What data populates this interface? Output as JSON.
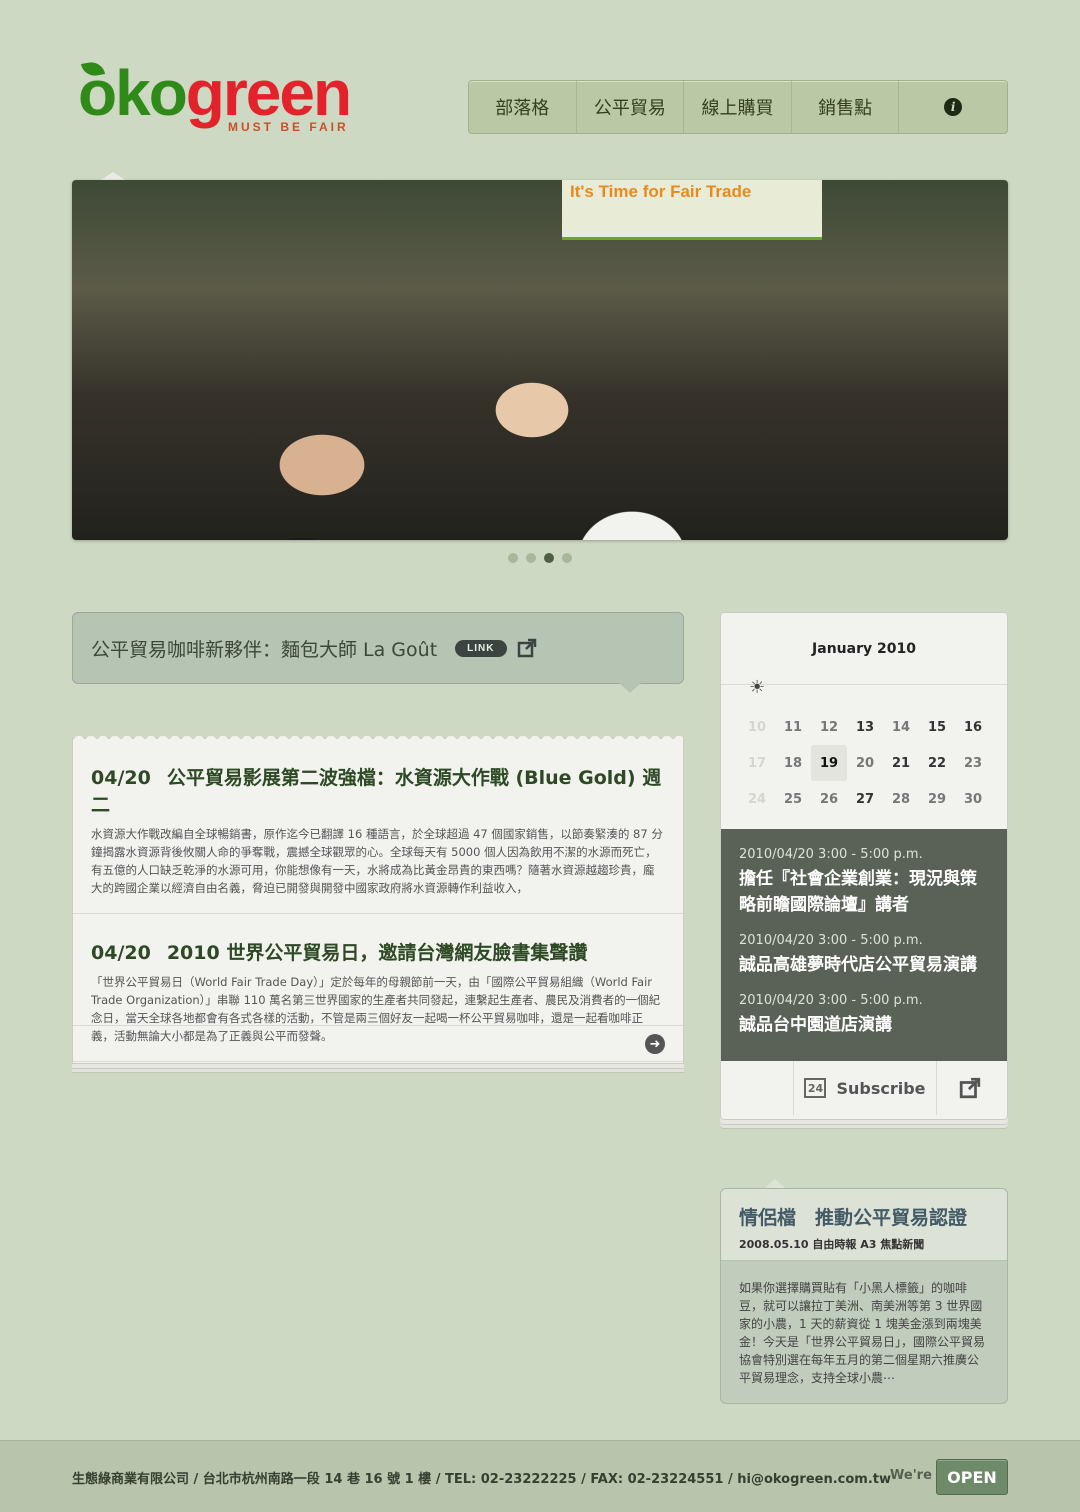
{
  "brand": {
    "logo_oko": "oko",
    "logo_green": "green",
    "tagline": "MUST BE FAIR"
  },
  "nav": {
    "items": [
      "部落格",
      "公平貿易",
      "線上購買",
      "銷售點"
    ],
    "info_icon": "info-icon"
  },
  "hero": {
    "sign_text": "It's Time for Fair Trade",
    "slides": 4,
    "active_slide": 3
  },
  "feature": {
    "title": "公平貿易咖啡新夥伴：麵包大師 La Goût",
    "badge": "LINK"
  },
  "news": [
    {
      "date": "04/20",
      "title": "公平貿易影展第二波強檔：水資源大作戰 (Blue Gold) 週二",
      "body": "水資源大作戰改編自全球暢銷書，原作迄今已翻譯 16 種語言，於全球超過 47 個國家銷售，以節奏緊湊的 87 分鐘揭露水資源背後攸關人命的爭奪戰，震撼全球觀眾的心。全球每天有 5000 個人因為飲用不潔的水源而死亡，有五億的人口缺乏乾淨的水源可用，你能想像有一天，水將成為比黃金昂貴的東西嗎？隨著水資源越趨珍貴，龐大的跨國企業以經濟自由名義，脅迫已開發與開發中國家政府將水資源轉作利益收入，"
    },
    {
      "date": "04/20",
      "title": "2010 世界公平貿易日，邀請台灣網友臉書集聲讚",
      "body": "「世界公平貿易日（World Fair Trade Day）」定於每年的母親節前一天，由「國際公平貿易組織（World Fair Trade Organization）」串聯 110 萬名第三世界國家的生產者共同發起，連繫起生產者、農民及消費者的一個紀念日，當天全球各地都會有各式各樣的活動，不管是兩三個好友一起喝一杯公平貿易咖啡，還是一起看咖啡正義，活動無論大小都是為了正義與公平而發聲。"
    }
  ],
  "calendar": {
    "month": "January 2010",
    "days": [
      {
        "d": "10",
        "s": "faded"
      },
      {
        "d": "11",
        "s": ""
      },
      {
        "d": "12",
        "s": ""
      },
      {
        "d": "13",
        "s": "dark"
      },
      {
        "d": "14",
        "s": ""
      },
      {
        "d": "15",
        "s": "dark"
      },
      {
        "d": "16",
        "s": "dark"
      },
      {
        "d": "17",
        "s": "faded"
      },
      {
        "d": "18",
        "s": ""
      },
      {
        "d": "19",
        "s": "today"
      },
      {
        "d": "20",
        "s": ""
      },
      {
        "d": "21",
        "s": "dark"
      },
      {
        "d": "22",
        "s": "dark"
      },
      {
        "d": "23",
        "s": ""
      },
      {
        "d": "24",
        "s": "faded"
      },
      {
        "d": "25",
        "s": ""
      },
      {
        "d": "26",
        "s": ""
      },
      {
        "d": "27",
        "s": "dark"
      },
      {
        "d": "28",
        "s": ""
      },
      {
        "d": "29",
        "s": ""
      },
      {
        "d": "30",
        "s": ""
      }
    ],
    "events": [
      {
        "time": "2010/04/20  3:00 - 5:00 p.m.",
        "title": "擔任『社會企業創業：現況與策略前瞻國際論壇』講者"
      },
      {
        "time": "2010/04/20  3:00 - 5:00 p.m.",
        "title": "誠品高雄夢時代店公平貿易演講"
      },
      {
        "time": "2010/04/20  3:00 - 5:00 p.m.",
        "title": "誠品台中園道店演講"
      }
    ],
    "subscribe_label": "Subscribe",
    "cal_icon_text": "24"
  },
  "press": {
    "title": "情侶檔　推動公平貿易認證",
    "source": "2008.05.10 自由時報 A3 焦點新聞",
    "body": "如果你選擇購買貼有「小黑人標籤」的咖啡豆，就可以讓拉丁美洲、南美洲等第 3 世界國家的小農，1 天的薪資從 1 塊美金漲到兩塊美金！今天是「世界公平貿易日」，國際公平貿易協會特別選在每年五月的第二個星期六推廣公平貿易理念，支持全球小農⋯"
  },
  "footer": {
    "text": "生態綠商業有限公司 / 台北市杭州南路一段 14 巷 16 號 1 樓 / TEL: 02-23222225 / FAX: 02-23224551 / hi@okogreen.com.tw",
    "were": "We're",
    "open": "OPEN"
  },
  "colors": {
    "background": "#cdd9c2",
    "logo_green": "#2f8a1a",
    "logo_red": "#e3232b",
    "event_panel": "#5a6258"
  }
}
